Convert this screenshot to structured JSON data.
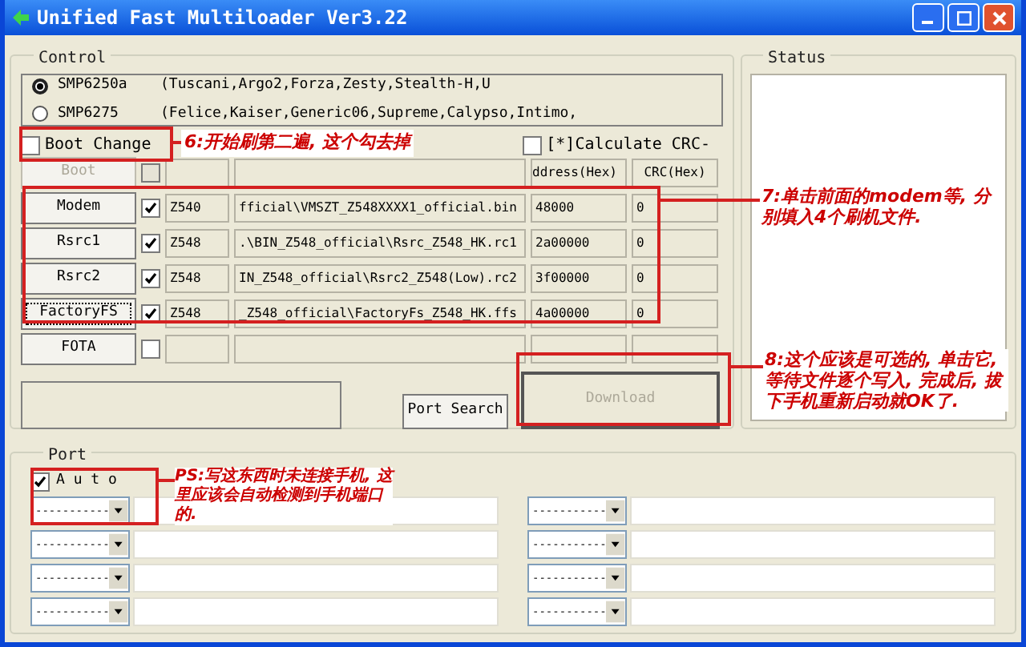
{
  "window": {
    "title": "Unified Fast Multiloader Ver3.22"
  },
  "control": {
    "title": "Control",
    "chipsets": [
      {
        "label": "SMP6250a",
        "models": "(Tuscani,Argo2,Forza,Zesty,Stealth-H,U",
        "selected": true
      },
      {
        "label": "SMP6275",
        "models": "(Felice,Kaiser,Generic06,Supreme,Calypso,Intimo,",
        "selected": false
      }
    ],
    "boot_change": {
      "label": "Boot Change",
      "checked": false
    },
    "calculate_crc": {
      "label": "[*]Calculate CRC-",
      "checked": false
    },
    "columns": [
      "ddress(Hex)",
      "CRC(Hex)"
    ],
    "files": [
      {
        "button": "Boot",
        "disabled": true,
        "checked": false,
        "focused": false
      },
      {
        "button": "Modem",
        "disabled": false,
        "checked": true,
        "focused": false,
        "name": "Z540",
        "path": "fficial\\VMSZT_Z548XXXX1_official.bin",
        "address": "48000",
        "crc": "0"
      },
      {
        "button": "Rsrc1",
        "disabled": false,
        "checked": true,
        "focused": false,
        "name": "Z548",
        "path": ".\\BIN_Z548_official\\Rsrc_Z548_HK.rc1",
        "address": "2a00000",
        "crc": "0"
      },
      {
        "button": "Rsrc2",
        "disabled": false,
        "checked": true,
        "focused": false,
        "name": "Z548",
        "path": "IN_Z548_official\\Rsrc2_Z548(Low).rc2",
        "address": "3f00000",
        "crc": "0"
      },
      {
        "button": "FactoryFS",
        "disabled": false,
        "checked": true,
        "focused": true,
        "name": "Z548",
        "path": "_Z548_official\\FactoryFs_Z548_HK.ffs",
        "address": "4a00000",
        "crc": "0"
      },
      {
        "button": "FOTA",
        "disabled": false,
        "checked": false,
        "focused": false
      }
    ],
    "port_search": {
      "label": "Port Search",
      "disabled": false
    },
    "download": {
      "label": "Download",
      "disabled": true
    }
  },
  "status": {
    "title": "Status"
  },
  "port": {
    "title": "Port",
    "auto": {
      "label": "A u t o",
      "checked": true
    },
    "ports": [
      {
        "value": "-----------"
      },
      {
        "value": "-----------"
      },
      {
        "value": "-----------"
      },
      {
        "value": "-----------"
      },
      {
        "value": "-----------"
      },
      {
        "value": "-----------"
      },
      {
        "value": "-----------"
      },
      {
        "value": "-----------"
      }
    ]
  },
  "annotations": [
    "6:开始刷第二遍, 这个勾去掉",
    "7:单击前面的modem等, 分别填入4个刷机文件.",
    "8:这个应该是可选的, 单击它, 等待文件逐个写入, 完成后, 拔下手机重新启动就OK了.",
    "PS:写这东西时未连接手机, 这里应该会自动检测到手机端口的."
  ]
}
